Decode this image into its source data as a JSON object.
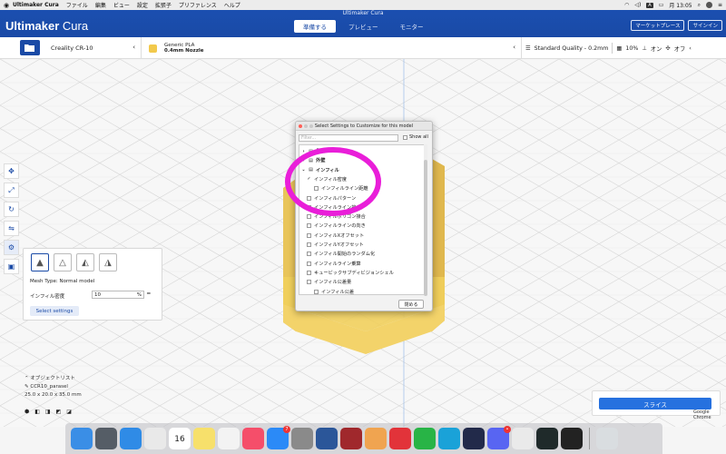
{
  "menubar": {
    "app_name": "Ultimaker Cura",
    "items": [
      "ファイル",
      "編集",
      "ビュー",
      "設定",
      "拡張子",
      "プリファレンス",
      "ヘルプ"
    ],
    "input_indicator": "A",
    "clock": "月 13:05"
  },
  "window": {
    "title": "Ultimaker Cura"
  },
  "header": {
    "logo_bold": "Ultimaker",
    "logo_light": "Cura",
    "tabs": [
      {
        "label": "準備する",
        "active": true
      },
      {
        "label": "プレビュー",
        "active": false
      },
      {
        "label": "モニター",
        "active": false
      }
    ],
    "marketplace_label": "マーケットプレース",
    "signin_label": "サインイン"
  },
  "toolbar": {
    "printer": "Creality CR-10",
    "material_name": "Generic PLA",
    "nozzle": "0.4mm Nozzle",
    "profile": "Standard Quality - 0.2mm",
    "infill_pct": "10%",
    "support": "オン",
    "adhesion": "オフ"
  },
  "mesh_panel": {
    "mesh_type": "Mesh Type: Normal model",
    "infill_label": "インフィル密度",
    "infill_value": "10",
    "infill_unit": "%",
    "select_settings_label": "Select settings"
  },
  "object_list": {
    "header": "オブジェクトリスト",
    "file": "CCR10_parasel",
    "dims": "25.0 x 20.0 x 35.0 mm"
  },
  "slice": {
    "label": "スライス"
  },
  "dialog": {
    "title": "Select Settings to Customize for this model",
    "filter_placeholder": "Filter...",
    "show_all": "Show all",
    "close_label": "閉める",
    "rows": [
      {
        "label": "品質",
        "kind": "category",
        "expanded": false
      },
      {
        "label": "外壁",
        "kind": "category",
        "expanded": false
      },
      {
        "label": "インフィル",
        "kind": "category",
        "expanded": true
      },
      {
        "label": "インフィル密度",
        "kind": "item",
        "checked": true,
        "indent": 1
      },
      {
        "label": "インフィルライン距離",
        "kind": "item",
        "checked": false,
        "indent": 2
      },
      {
        "label": "インフィルパターン",
        "kind": "item",
        "checked": false,
        "indent": 1
      },
      {
        "label": "インフィルライン接合",
        "kind": "item",
        "checked": false,
        "indent": 1
      },
      {
        "label": "インフィルポリゴン接合",
        "kind": "item",
        "checked": false,
        "indent": 1
      },
      {
        "label": "インフィルラインの向き",
        "kind": "item",
        "checked": false,
        "indent": 1
      },
      {
        "label": "インフィルXオフセット",
        "kind": "item",
        "checked": false,
        "indent": 1
      },
      {
        "label": "インフィルYオフセット",
        "kind": "item",
        "checked": false,
        "indent": 1
      },
      {
        "label": "インフィル開始のランダム化",
        "kind": "item",
        "checked": false,
        "indent": 1
      },
      {
        "label": "インフィルライン乗算",
        "kind": "item",
        "checked": false,
        "indent": 1
      },
      {
        "label": "キュービックサブディビジョンシェル",
        "kind": "item",
        "checked": false,
        "indent": 1
      },
      {
        "label": "インフィル公差量",
        "kind": "item",
        "checked": false,
        "indent": 1
      },
      {
        "label": "インフィル公差",
        "kind": "item",
        "checked": false,
        "indent": 2
      }
    ]
  },
  "dock": {
    "apps": [
      {
        "name": "finder-icon",
        "color": "#3a8ee6"
      },
      {
        "name": "launchpad-icon",
        "color": "#555d66"
      },
      {
        "name": "safari-icon",
        "color": "#2f8be6"
      },
      {
        "name": "chrome-icon",
        "color": "#e9e9e9"
      },
      {
        "name": "calendar-icon",
        "color": "#ffffff"
      },
      {
        "name": "notes-icon",
        "color": "#f7e06b"
      },
      {
        "name": "photos-icon",
        "color": "#f3f3f3"
      },
      {
        "name": "music-icon",
        "color": "#f54e6a"
      },
      {
        "name": "appstore-icon",
        "color": "#2b8af7",
        "badge": "7"
      },
      {
        "name": "settings-icon",
        "color": "#8a8a8a"
      },
      {
        "name": "word-icon",
        "color": "#2b5699"
      },
      {
        "name": "dictionary-icon",
        "color": "#a0282c"
      },
      {
        "name": "fusion-icon",
        "color": "#f0a450"
      },
      {
        "name": "mail-icon",
        "color": "#e2333a"
      },
      {
        "name": "line-icon",
        "color": "#28b446"
      },
      {
        "name": "cura-icon",
        "color": "#1aa2d8"
      },
      {
        "name": "audio-icon",
        "color": "#222a4a"
      },
      {
        "name": "discord-icon",
        "color": "#5865f2",
        "badge": "•"
      },
      {
        "name": "blender-icon",
        "color": "#eaeaea"
      },
      {
        "name": "filmora-icon",
        "color": "#1f2a2a"
      },
      {
        "name": "media-icon",
        "color": "#222222"
      },
      {
        "name": "trash-icon",
        "color": "#d9dde0"
      }
    ],
    "tooltip": "Google Chrome",
    "calendar_day": "16"
  },
  "colors": {
    "accent": "#1a4aa6",
    "model": "#f1cf5c",
    "annotation": "#e91ed9"
  }
}
